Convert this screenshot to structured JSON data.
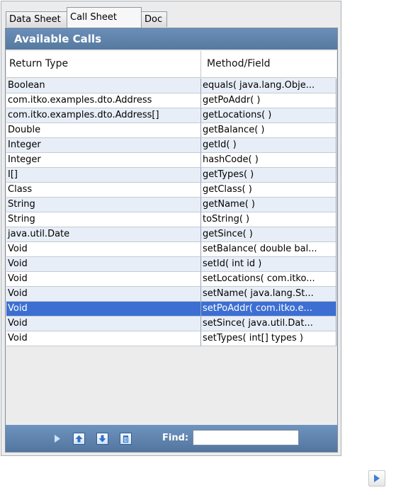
{
  "tabs": [
    {
      "label": "Data Sheet",
      "active": false
    },
    {
      "label": "Call Sheet",
      "active": true
    },
    {
      "label": "Doc",
      "active": false
    }
  ],
  "panel": {
    "title": "Available Calls",
    "columns": [
      "Return Type",
      "Method/Field"
    ],
    "rows": [
      {
        "return_type": "Boolean",
        "method": "equals( java.lang.Obje..."
      },
      {
        "return_type": "com.itko.examples.dto.Address",
        "method": "getPoAddr( )"
      },
      {
        "return_type": "com.itko.examples.dto.Address[]",
        "method": "getLocations( )"
      },
      {
        "return_type": "Double",
        "method": "getBalance( )"
      },
      {
        "return_type": "Integer",
        "method": "getId( )"
      },
      {
        "return_type": "Integer",
        "method": "hashCode( )"
      },
      {
        "return_type": "I[]",
        "method": "getTypes( )"
      },
      {
        "return_type": "Class",
        "method": "getClass( )"
      },
      {
        "return_type": "String",
        "method": "getName( )"
      },
      {
        "return_type": "String",
        "method": "toString( )"
      },
      {
        "return_type": "java.util.Date",
        "method": "getSince( )"
      },
      {
        "return_type": "Void",
        "method": "setBalance( double bal..."
      },
      {
        "return_type": "Void",
        "method": "setId( int id )"
      },
      {
        "return_type": "Void",
        "method": "setLocations( com.itko..."
      },
      {
        "return_type": "Void",
        "method": "setName( java.lang.St..."
      },
      {
        "return_type": "Void",
        "method": "setPoAddr( com.itko.e...",
        "selected": true
      },
      {
        "return_type": "Void",
        "method": "setSince( java.util.Dat..."
      },
      {
        "return_type": "Void",
        "method": "setTypes( int[] types )"
      }
    ]
  },
  "toolbar": {
    "icons": [
      "play-icon",
      "move-up-icon",
      "move-down-icon",
      "delete-icon"
    ],
    "find_label": "Find:",
    "find_value": ""
  },
  "outside": {
    "icon": "play-icon"
  },
  "colors": {
    "accent": "#5a7ea6",
    "selected_row": "#3d6fd3",
    "alt_row": "#e8eef7",
    "play_arrow": "#3e7fd0"
  }
}
